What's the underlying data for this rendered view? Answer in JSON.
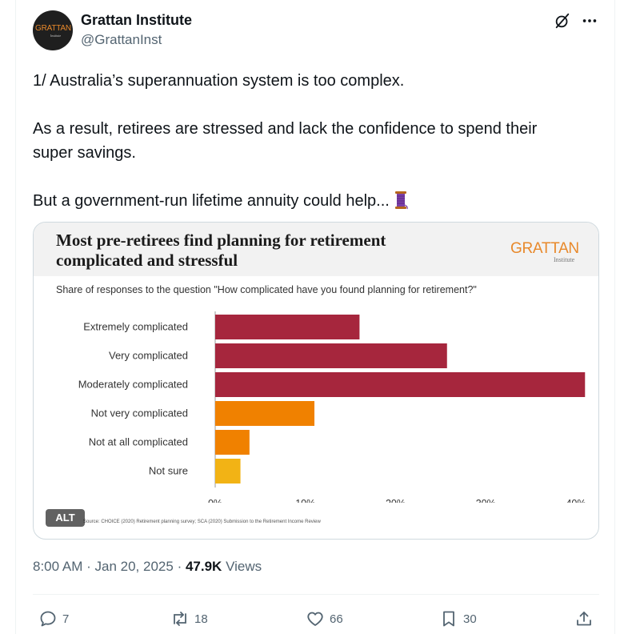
{
  "author": {
    "name": "Grattan Institute",
    "handle": "@GrattanInst",
    "avatar_text": "GRATTAN",
    "avatar_subtext": "Institute"
  },
  "tweet": {
    "line1": "1/ Australia’s superannuation system is too complex.",
    "line2": "As a result, retirees are stressed and lack the confidence to spend their",
    "line3": "super savings.",
    "line4": "But a government-run lifetime annuity could help...",
    "emoji": "spool-of-thread-icon"
  },
  "card": {
    "title_line1": "Most pre-retirees find planning for retirement",
    "title_line2": "complicated and stressful",
    "brand": "GRATTAN",
    "brand_sub": "Institute",
    "question": "Share of responses to the question \"How complicated have you found planning for retirement?\"",
    "source": "Source: CHOICE (2020) Retirement planning survey; SCA (2020) Submission to the Retirement Income Review",
    "alt_label": "ALT"
  },
  "chart_data": {
    "type": "bar",
    "orientation": "horizontal",
    "categories": [
      "Extremely complicated",
      "Very complicated",
      "Moderately complicated",
      "Not very complicated",
      "Not at all complicated",
      "Not sure"
    ],
    "values": [
      16,
      25.7,
      41,
      11,
      3.8,
      2.8
    ],
    "colors": [
      "#a6263d",
      "#a6263d",
      "#a6263d",
      "#f08100",
      "#f08100",
      "#f2b315"
    ],
    "xlim": [
      0,
      40
    ],
    "xticks": [
      "0%",
      "10%",
      "20%",
      "30%",
      "40%"
    ],
    "xtick_values": [
      0,
      10,
      20,
      30,
      40
    ],
    "grid": false
  },
  "meta": {
    "time": "8:00 AM",
    "sep": "·",
    "date": "Jan 20, 2025",
    "views_count": "47.9K",
    "views_label": "Views"
  },
  "actions": {
    "replies": "7",
    "reposts": "18",
    "likes": "66",
    "bookmarks": "30"
  },
  "colors": {
    "text": "#0f1419",
    "secondary": "#536471",
    "maroon": "#a6263d",
    "orange": "#f08100",
    "yellow": "#f2b315",
    "brand_orange": "#e8892b"
  }
}
